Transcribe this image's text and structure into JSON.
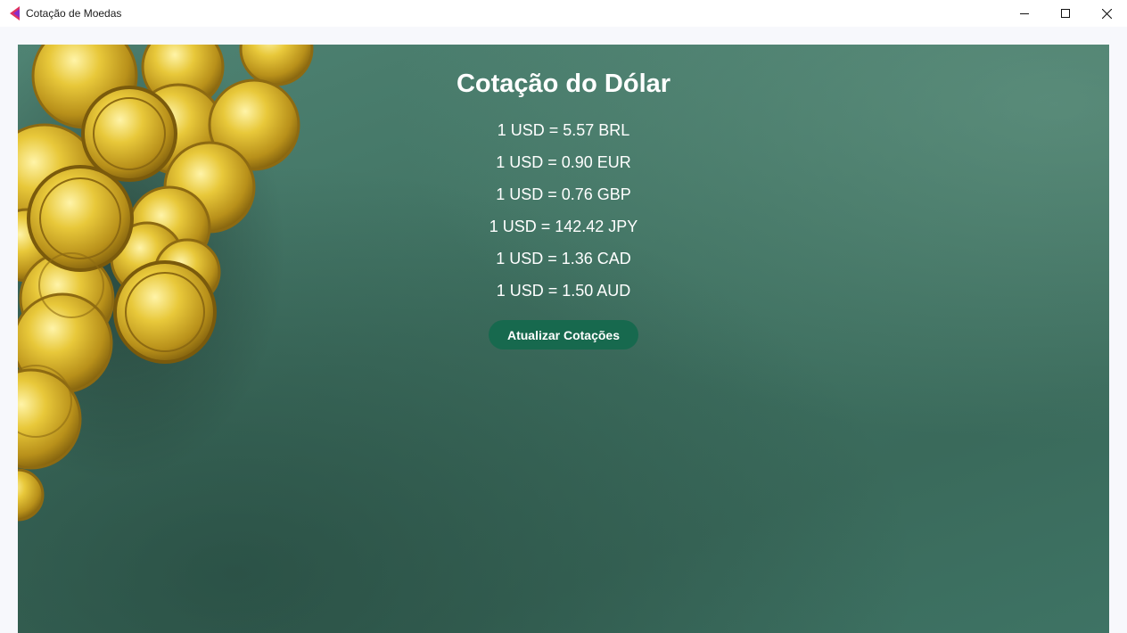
{
  "window": {
    "title": "Cotação de Moedas",
    "icon": "app-logo-icon",
    "controls": [
      "minimize-icon",
      "maximize-icon",
      "close-icon"
    ]
  },
  "main": {
    "title": "Cotação do Dólar",
    "rates": [
      "1 USD = 5.57 BRL",
      "1 USD = 0.90 EUR",
      "1 USD = 0.76 GBP",
      "1 USD = 142.42 JPY",
      "1 USD = 1.36 CAD",
      "1 USD = 1.50 AUD"
    ],
    "update_button_label": "Atualizar Cotações"
  },
  "colors": {
    "button_background": "#17694e",
    "panel_background": "#3f7161",
    "text": "#ffffff"
  }
}
